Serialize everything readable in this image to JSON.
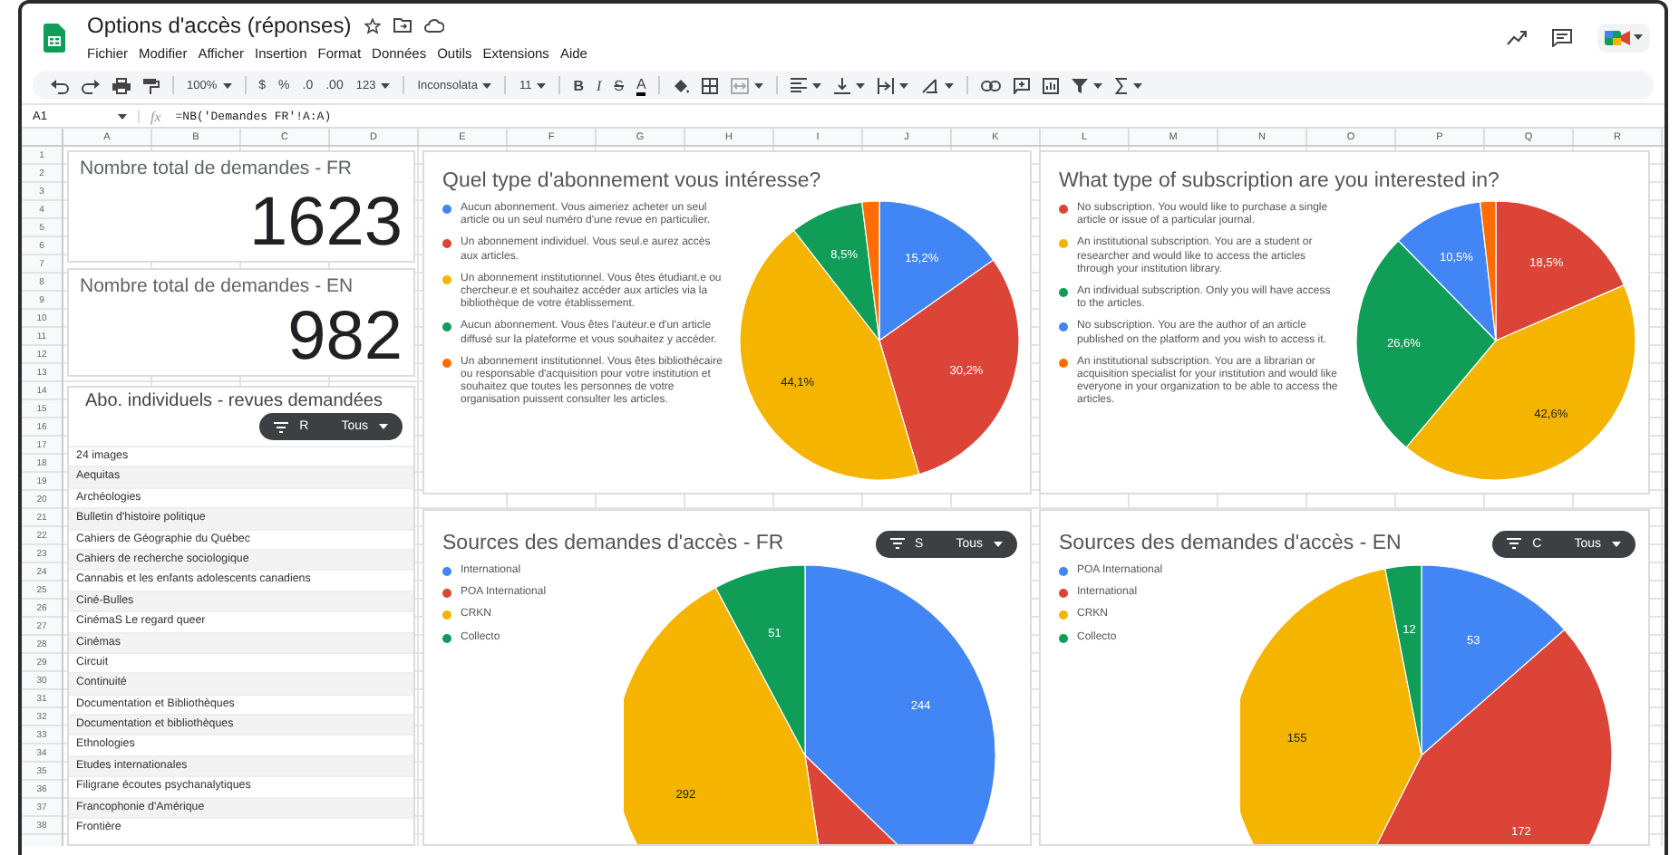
{
  "document": {
    "title": "Options d'accès (réponses)"
  },
  "menu": [
    "Fichier",
    "Modifier",
    "Afficher",
    "Insertion",
    "Format",
    "Données",
    "Outils",
    "Extensions",
    "Aide"
  ],
  "toolbar": {
    "zoom": "100%",
    "currency": "$",
    "percent": "%",
    "decimal_decrease": ".0",
    "decimal_increase": ".00",
    "number_formats": "123",
    "font": "Inconsolata",
    "font_size": "11",
    "bold": "B",
    "italic": "I",
    "strikethrough": "S",
    "text_color": "A"
  },
  "formula_bar": {
    "cell": "A1",
    "fx": "fx",
    "formula": "=NB('Demandes FR'!A:A)"
  },
  "columns": [
    "A",
    "B",
    "C",
    "D",
    "E",
    "F",
    "G",
    "H",
    "I",
    "J",
    "K",
    "L",
    "M",
    "N",
    "O",
    "P",
    "Q",
    "R"
  ],
  "rows": [
    "1",
    "2",
    "3",
    "4",
    "5",
    "6",
    "7",
    "8",
    "9",
    "10",
    "11",
    "12",
    "13",
    "14",
    "15",
    "16",
    "17",
    "18",
    "19",
    "20",
    "21",
    "22",
    "23",
    "24",
    "25",
    "26",
    "27",
    "28",
    "29",
    "30",
    "31",
    "32",
    "33",
    "34",
    "35",
    "36",
    "37",
    "38"
  ],
  "scorecards": [
    {
      "title": "Nombre total de demandes - FR",
      "value": "1623"
    },
    {
      "title": "Nombre total de demandes - EN",
      "value": "982"
    }
  ],
  "list_panel": {
    "title": "Abo. individuels - revues demandées",
    "filter": {
      "label": "R",
      "value": "Tous"
    },
    "items": [
      "24 images",
      "Aequitas",
      "Archéologies",
      "Bulletin d'histoire politique",
      "Cahiers de Géographie du Québec",
      "Cahiers de recherche sociologique",
      "Cannabis et les enfants adolescents canadiens",
      "Ciné-Bulles",
      "CinémaS Le regard queer",
      "Cinémas",
      "Circuit",
      "Continuité",
      "Documentation et Bibliothèques",
      "Documentation et bibliothèques",
      "Ethnologies",
      "Etudes internationales",
      "Filigrane écoutes psychanalytiques",
      "Francophonie d'Amérique",
      "Frontière"
    ]
  },
  "charts": [
    {
      "chart_data": {
        "type": "pie",
        "title": "Quel type d'abonnement vous intéresse?",
        "categories": [
          "Aucun abonnement. Vous aimeriez acheter un seul article ou un seul numéro d'une revue en particulier.",
          "Un abonnement individuel. Vous seul.e aurez accès aux articles.",
          "Un abonnement institutionnel. Vous êtes étudiant.e ou chercheur.e et souhaitez accéder aux articles via la bibliothèque de votre établissement.",
          "Aucun abonnement. Vous êtes l'auteur.e d'un article diffusé sur la plateforme et vous souhaitez y accéder.",
          "Un abonnement institutionnel. Vous êtes bibliothécaire ou responsable d'acquisition pour votre institution et souhaitez que toutes les personnes de votre organisation puissent consulter les articles."
        ],
        "values": [
          15.2,
          30.2,
          44.1,
          8.5,
          2.0
        ],
        "colors": [
          "#4285f4",
          "#db4437",
          "#f4b400",
          "#0f9d58",
          "#ff6d01"
        ],
        "value_labels": [
          "15,2%",
          "30,2%",
          "44,1%",
          "8,5%",
          null
        ]
      }
    },
    {
      "chart_data": {
        "type": "pie",
        "title": "What type of subscription are you interested in?",
        "categories": [
          "No subscription. You would like to purchase a single article or issue of a particular journal.",
          "An institutional subscription. You are a student or researcher and would like to access the articles through your institution library.",
          "An individual subscription. Only you will have access to the articles.",
          "No subscription. You are the author of an article published on the platform and you wish to access it.",
          "An institutional subscription. You are a librarian or acquisition specialist for your institution and would like everyone in your organization to be able to access the articles."
        ],
        "values": [
          18.5,
          42.6,
          26.6,
          10.5,
          1.8
        ],
        "colors": [
          "#db4437",
          "#f4b400",
          "#0f9d58",
          "#4285f4",
          "#ff6d01"
        ],
        "value_labels": [
          "18,5%",
          "42,6%",
          "26,6%",
          "10,5%",
          null
        ]
      }
    },
    {
      "filter": {
        "label": "S",
        "value": "Tous"
      },
      "chart_data": {
        "type": "pie",
        "title": "Sources des demandes d'accès - FR",
        "categories": [
          "International",
          "POA International",
          "CRKN",
          "Collecto"
        ],
        "values": [
          244,
          68,
          292,
          51
        ],
        "colors": [
          "#4285f4",
          "#db4437",
          "#f4b400",
          "#0f9d58"
        ],
        "value_labels": [
          "244",
          null,
          "292",
          "51"
        ]
      }
    },
    {
      "filter": {
        "label": "C",
        "value": "Tous"
      },
      "chart_data": {
        "type": "pie",
        "title": "Sources des demandes d'accès - EN",
        "categories": [
          "POA International",
          "International",
          "CRKN",
          "Collecto"
        ],
        "values": [
          53,
          172,
          155,
          12
        ],
        "colors": [
          "#4285f4",
          "#db4437",
          "#f4b400",
          "#0f9d58"
        ],
        "value_labels": [
          "53",
          "172",
          "155",
          "12"
        ]
      }
    }
  ]
}
